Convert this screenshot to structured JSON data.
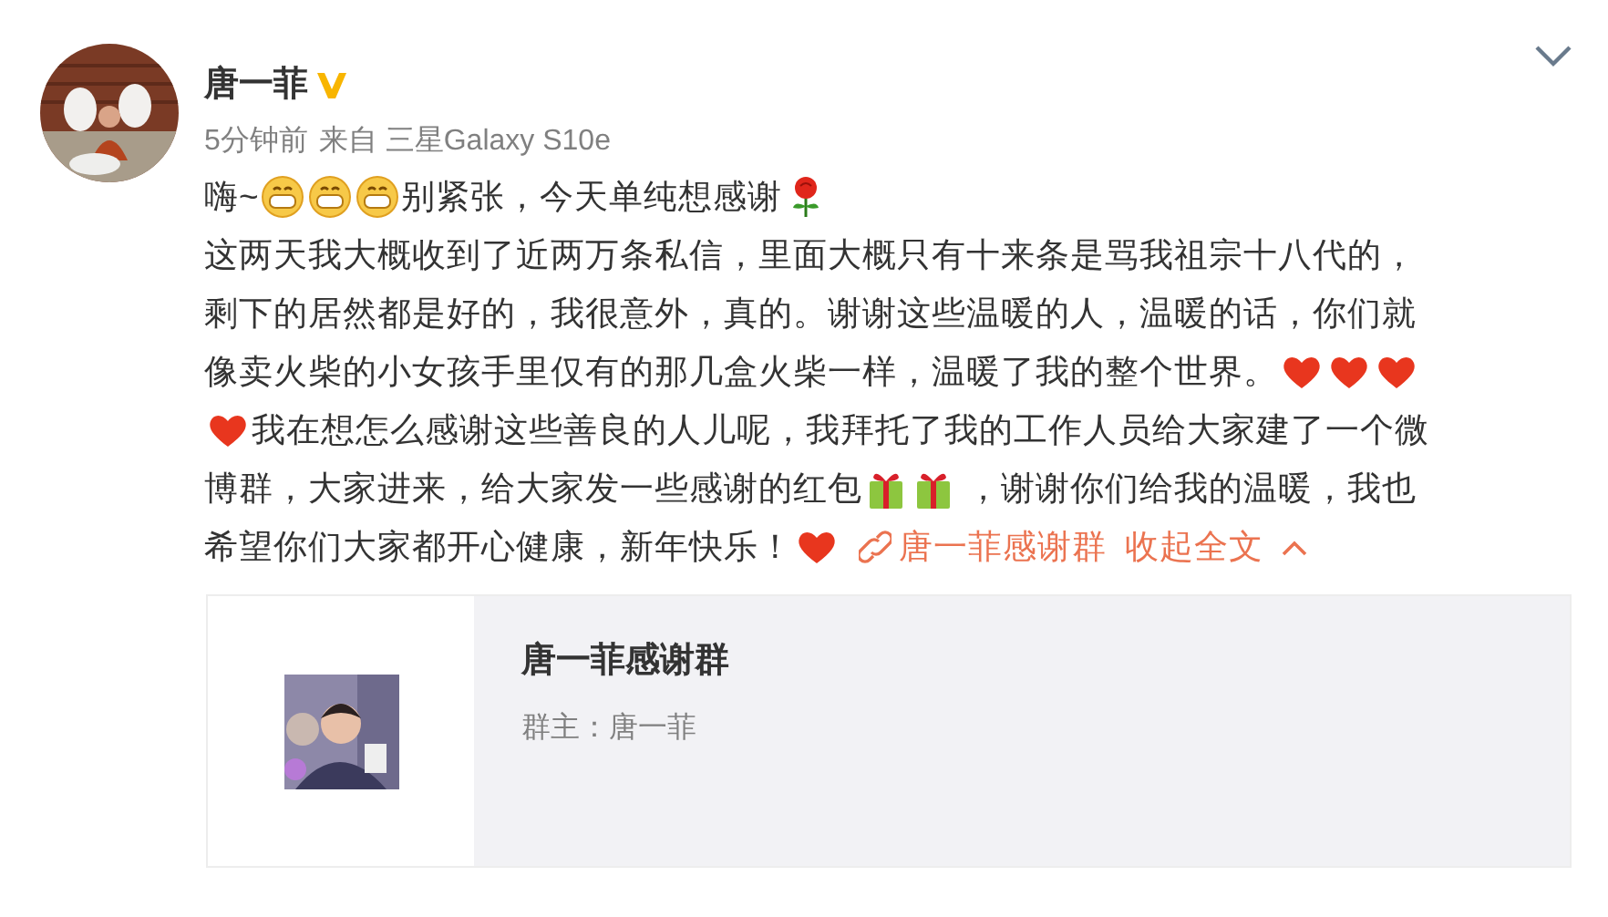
{
  "post": {
    "author": "唐一菲",
    "verified": true,
    "time": "5分钟前",
    "source": "来自 三星Galaxy S10e",
    "lines": [
      [
        {
          "kind": "text",
          "text": "嗨~"
        },
        {
          "kind": "grin"
        },
        {
          "kind": "grin"
        },
        {
          "kind": "grin"
        },
        {
          "kind": "text",
          "text": "别紧张，今天单纯想感谢"
        },
        {
          "kind": "rose"
        }
      ],
      [
        {
          "kind": "text",
          "text": "这两天我大概收到了近两万条私信，里面大概只有十来条是骂我祖宗十八代的，"
        }
      ],
      [
        {
          "kind": "text",
          "text": "剩下的居然都是好的，我很意外，真的。谢谢这些温暖的人，温暖的话，你们就"
        }
      ],
      [
        {
          "kind": "text",
          "text": "像卖火柴的小女孩手里仅有的那几盒火柴一样，温暖了我的整个世界。"
        },
        {
          "kind": "heart"
        },
        {
          "kind": "heart"
        },
        {
          "kind": "heart"
        }
      ],
      [
        {
          "kind": "heart"
        },
        {
          "kind": "text",
          "text": "我在想怎么感谢这些善良的人儿呢，我拜托了我的工作人员给大家建了一个微"
        }
      ],
      [
        {
          "kind": "text",
          "text": "博群，大家进来，给大家发一些感谢的红包"
        },
        {
          "kind": "gift"
        },
        {
          "kind": "gift"
        },
        {
          "kind": "text",
          "text": " ，谢谢你们给我的温暖，我也"
        }
      ],
      [
        {
          "kind": "text",
          "text": "希望你们大家都开心健康，新年快乐！"
        },
        {
          "kind": "heart"
        }
      ]
    ],
    "group_link": "唐一菲感谢群",
    "collapse": "收起全文"
  },
  "group_card": {
    "title": "唐一菲感谢群",
    "owner": "群主：唐一菲"
  }
}
